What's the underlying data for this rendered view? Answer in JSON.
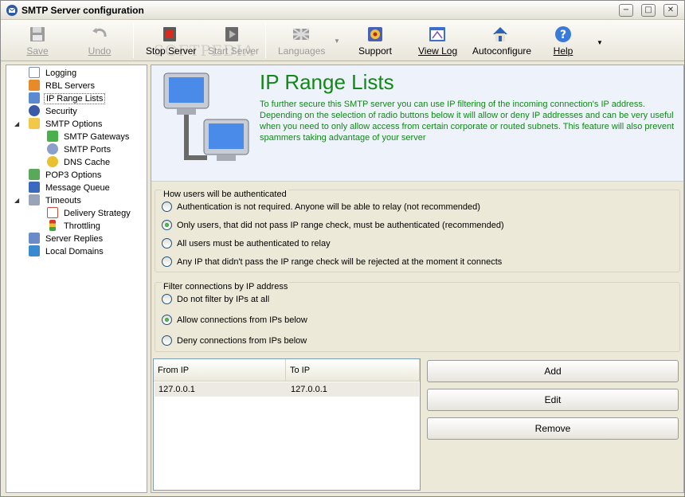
{
  "window": {
    "title": "SMTP Server configuration",
    "minimize_glyph": "−",
    "maximize_glyph": "□",
    "close_glyph": "✕"
  },
  "watermark": "SOFTPEDIA",
  "toolbar": {
    "save": "Save",
    "undo": "Undo",
    "stop_server": "Stop Server",
    "start_server": "Start Server",
    "languages": "Languages",
    "support": "Support",
    "view_log": "View Log",
    "autoconfigure": "Autoconfigure",
    "help": "Help",
    "dropdown_glyph": "▼",
    "more_glyph": "▼"
  },
  "tree": {
    "expander_glyph": "◢",
    "items": [
      {
        "label": "Logging",
        "icon": "log-icon"
      },
      {
        "label": "RBL Servers",
        "icon": "rbl-icon"
      },
      {
        "label": "IP Range Lists",
        "icon": "ip-range-icon"
      },
      {
        "label": "Security",
        "icon": "security-icon"
      },
      {
        "label": "SMTP Options",
        "icon": "smtp-options-icon"
      },
      {
        "label": "SMTP Gateways",
        "icon": "gateways-icon"
      },
      {
        "label": "SMTP Ports",
        "icon": "ports-icon"
      },
      {
        "label": "DNS Cache",
        "icon": "dns-icon"
      },
      {
        "label": "POP3 Options",
        "icon": "pop3-icon"
      },
      {
        "label": "Message Queue",
        "icon": "queue-icon"
      },
      {
        "label": "Timeouts",
        "icon": "timeouts-icon"
      },
      {
        "label": "Delivery Strategy",
        "icon": "calendar-icon"
      },
      {
        "label": "Throttling",
        "icon": "traffic-light-icon"
      },
      {
        "label": "Server Replies",
        "icon": "server-replies-icon"
      },
      {
        "label": "Local Domains",
        "icon": "local-domains-icon"
      }
    ]
  },
  "header": {
    "title": "IP Range Lists",
    "description": "To further secure this SMTP server you can use IP filtering of the incoming connection's IP address. Depending on the selection of radio buttons below it will allow or deny IP addresses and can be very useful when you need to only allow access from certain corporate or routed subnets. This feature will also prevent spammers taking advantage of your server"
  },
  "auth_group": {
    "title": "How users will be authenticated",
    "options": [
      {
        "label": "Authentication is not required. Anyone will be able to relay (not recommended)",
        "checked": false
      },
      {
        "label": "Only users, that did not pass IP range check, must be authenticated (recommended)",
        "checked": true
      },
      {
        "label": "All users must be authenticated to relay",
        "checked": false
      },
      {
        "label": "Any IP that didn't pass the IP range check will be rejected at the moment it connects",
        "checked": false
      }
    ]
  },
  "filter_group": {
    "title": "Filter connections by IP address",
    "options": [
      {
        "label": "Do not filter by IPs at all",
        "checked": false
      },
      {
        "label": "Allow connections from IPs below",
        "checked": true
      },
      {
        "label": "Deny connections from IPs below",
        "checked": false
      }
    ]
  },
  "ip_list": {
    "columns": [
      "From IP",
      "To IP"
    ],
    "rows": [
      {
        "from": "127.0.0.1",
        "to": "127.0.0.1"
      }
    ]
  },
  "buttons": {
    "add": "Add",
    "edit": "Edit",
    "remove": "Remove"
  }
}
